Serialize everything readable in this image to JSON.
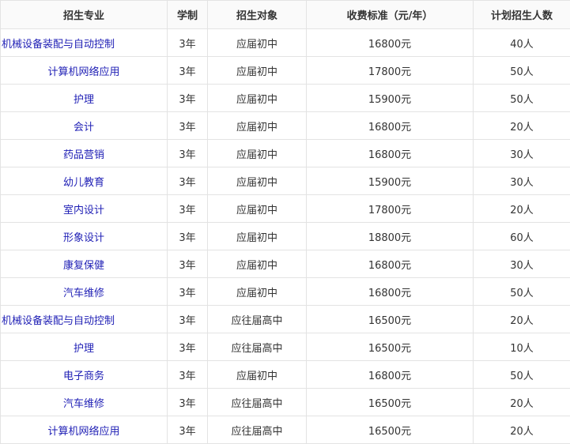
{
  "colors": {
    "major_text": "#1f1fb5",
    "border": "#e3e3e3",
    "text": "#333333"
  },
  "table": {
    "headers": [
      "招生专业",
      "学制",
      "招生对象",
      "收费标准（元/年）",
      "计划招生人数"
    ],
    "rows": [
      [
        "机械设备装配与自动控制",
        "3年",
        "应届初中",
        "16800元",
        "40人"
      ],
      [
        "计算机网络应用",
        "3年",
        "应届初中",
        "17800元",
        "50人"
      ],
      [
        "护理",
        "3年",
        "应届初中",
        "15900元",
        "50人"
      ],
      [
        "会计",
        "3年",
        "应届初中",
        "16800元",
        "20人"
      ],
      [
        "药品营销",
        "3年",
        "应届初中",
        "16800元",
        "30人"
      ],
      [
        "幼儿教育",
        "3年",
        "应届初中",
        "15900元",
        "30人"
      ],
      [
        "室内设计",
        "3年",
        "应届初中",
        "17800元",
        "20人"
      ],
      [
        "形象设计",
        "3年",
        "应届初中",
        "18800元",
        "60人"
      ],
      [
        "康复保健",
        "3年",
        "应届初中",
        "16800元",
        "30人"
      ],
      [
        "汽车维修",
        "3年",
        "应届初中",
        "16800元",
        "50人"
      ],
      [
        "机械设备装配与自动控制",
        "3年",
        "应往届高中",
        "16500元",
        "20人"
      ],
      [
        "护理",
        "3年",
        "应往届高中",
        "16500元",
        "10人"
      ],
      [
        "电子商务",
        "3年",
        "应届初中",
        "16800元",
        "50人"
      ],
      [
        "汽车维修",
        "3年",
        "应往届高中",
        "16500元",
        "20人"
      ],
      [
        "计算机网络应用",
        "3年",
        "应往届高中",
        "16500元",
        "20人"
      ]
    ]
  }
}
